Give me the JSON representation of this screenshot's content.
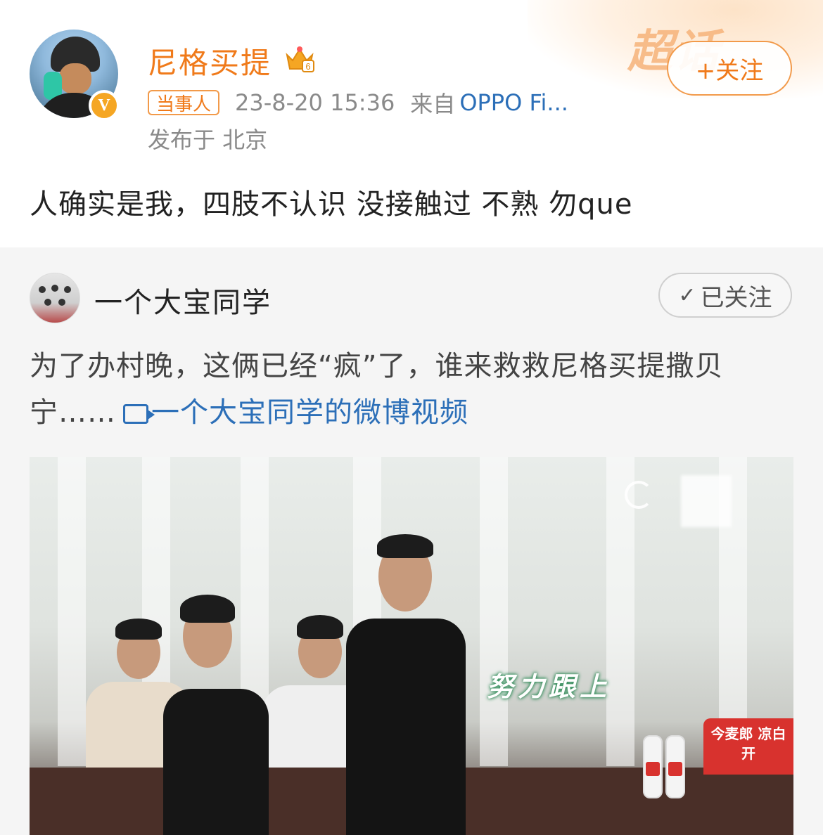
{
  "post": {
    "username": "尼格买提",
    "crown_badge": "6",
    "verified": "V",
    "follow_label": "+关注",
    "decor_text": "超话",
    "tag": "当事人",
    "datetime": "23-8-20 15:36",
    "source_prefix": "来自",
    "source": "OPPO Fi...",
    "location": "发布于 北京",
    "content": "人确实是我，四肢不认识 没接触过 不熟 勿que"
  },
  "repost": {
    "author": "一个大宝同学",
    "followed_label": "已关注",
    "text": "为了办村晚，这俩已经“疯”了，谁来救救尼格买提撒贝宁……",
    "video_link": "一个大宝同学的微博视频",
    "video": {
      "caption": "努力跟上",
      "brand_text": "今麦郎 凉白开",
      "bottle_label": "凉白开"
    }
  },
  "colors": {
    "accent_orange": "#f07a1a",
    "link_blue": "#2c6fb8",
    "repost_bg": "#f5f5f5"
  },
  "icons": [
    "crown-icon",
    "verified-badge-icon",
    "check-icon",
    "video-icon"
  ]
}
